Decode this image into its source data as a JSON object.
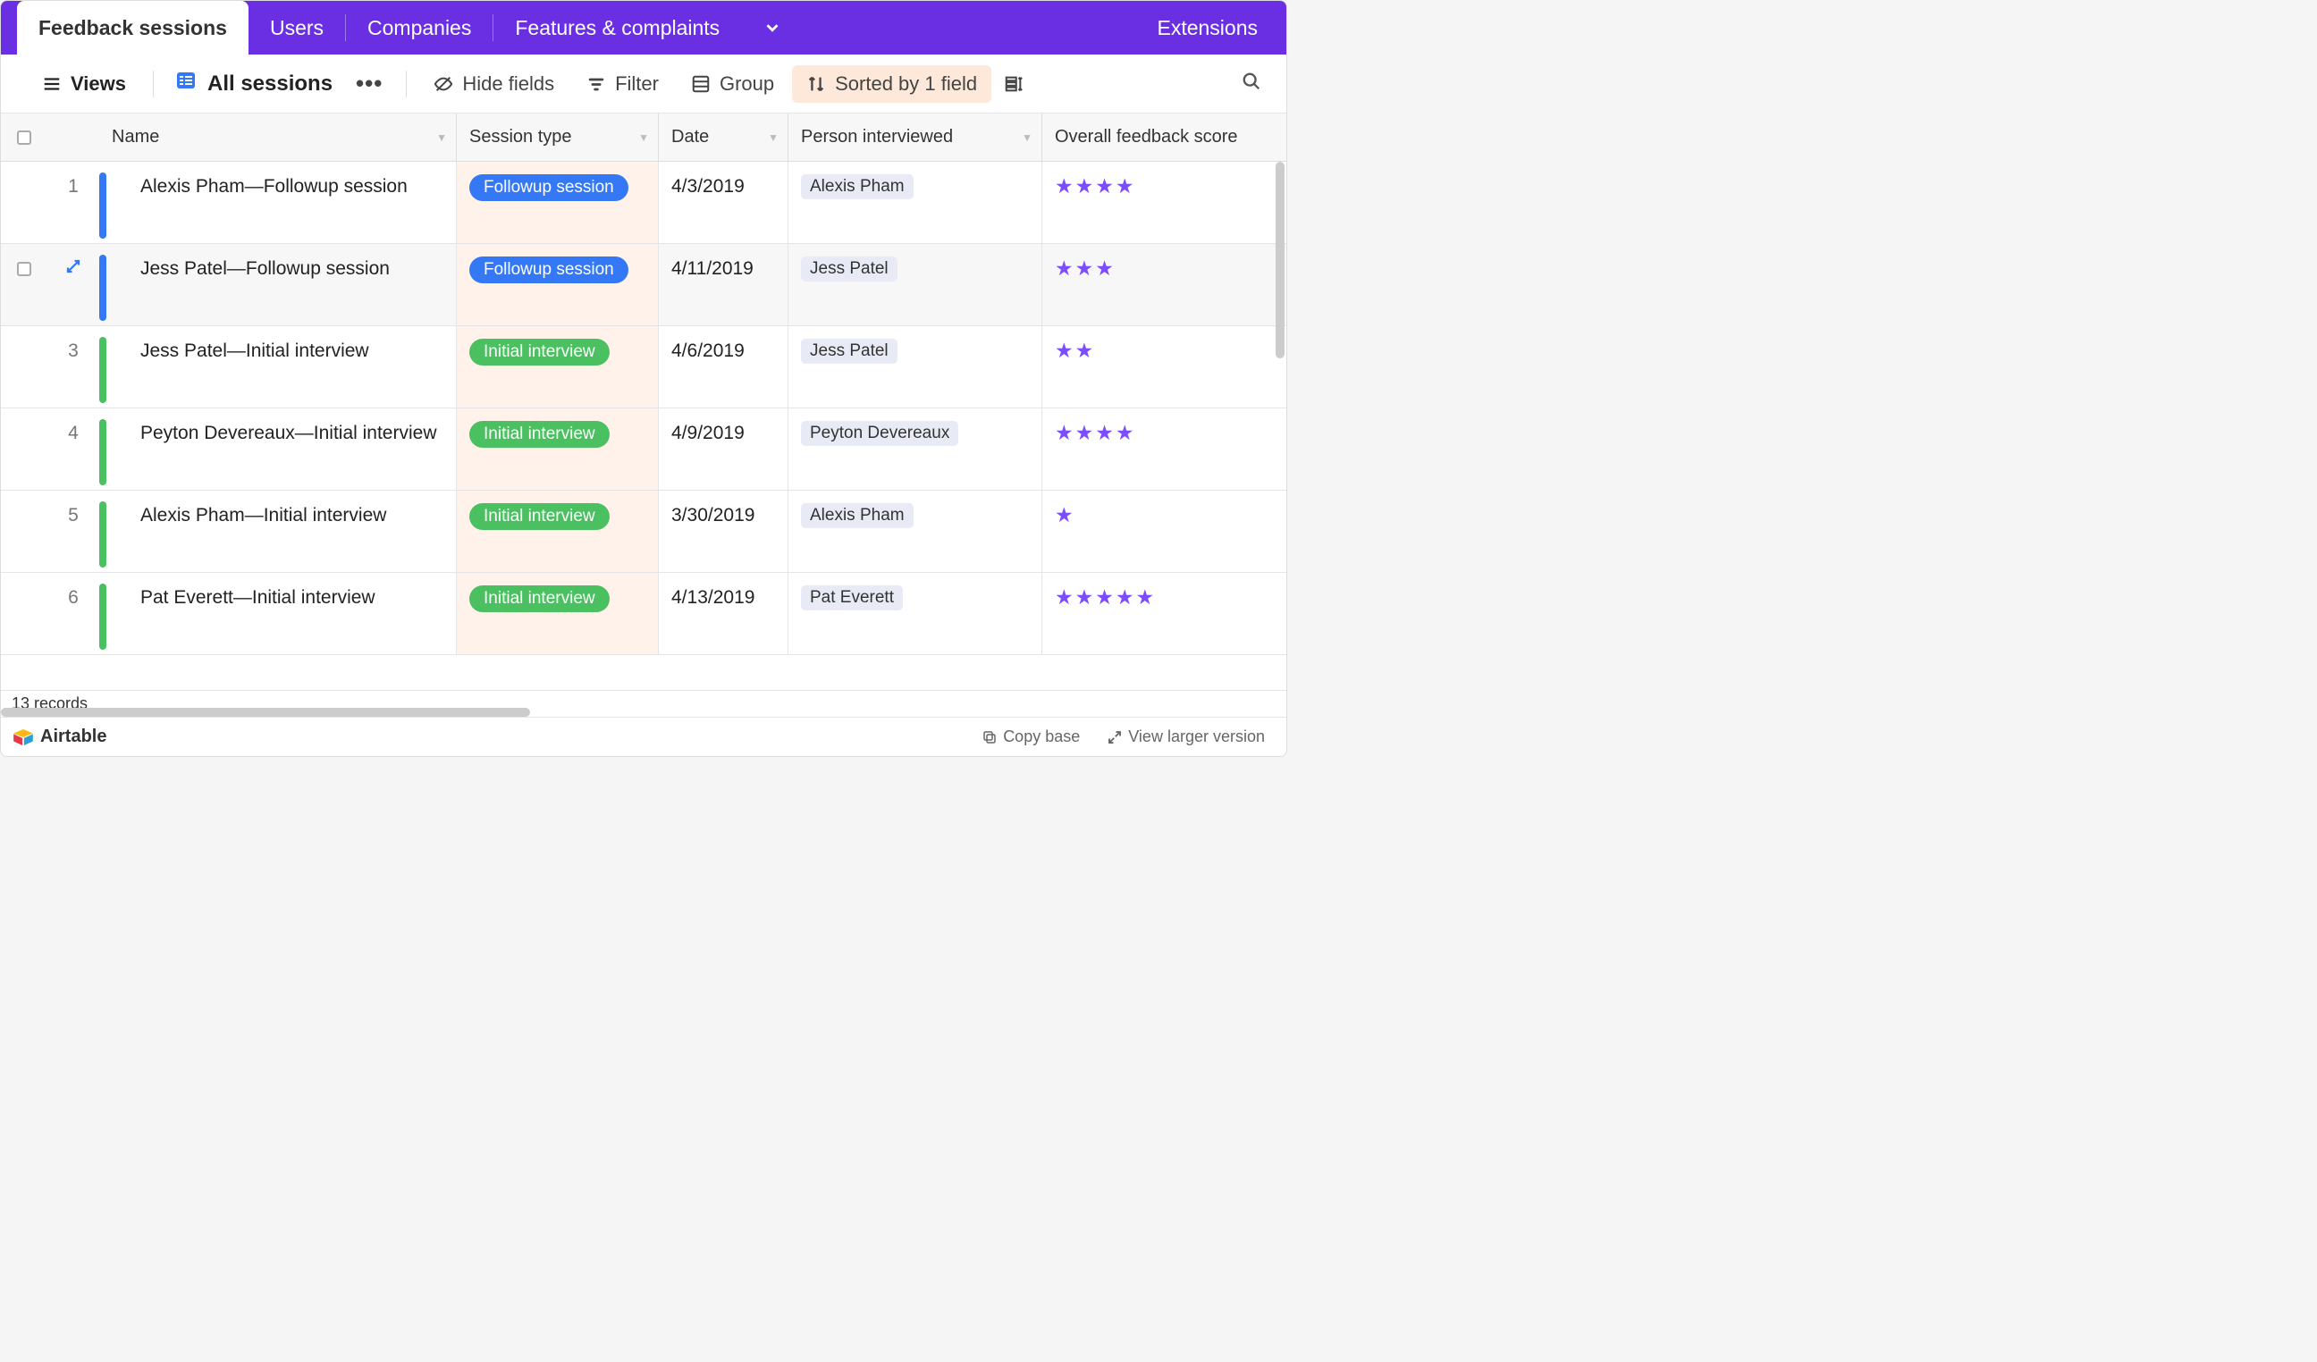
{
  "tabs": {
    "items": [
      {
        "label": "Feedback sessions",
        "active": true
      },
      {
        "label": "Users",
        "active": false
      },
      {
        "label": "Companies",
        "active": false
      },
      {
        "label": "Features & complaints",
        "active": false
      }
    ],
    "extensions_label": "Extensions"
  },
  "toolbar": {
    "views_label": "Views",
    "view_name": "All sessions",
    "hide_fields_label": "Hide fields",
    "filter_label": "Filter",
    "group_label": "Group",
    "sorted_label": "Sorted by 1 field"
  },
  "columns": {
    "name": "Name",
    "session_type": "Session type",
    "date": "Date",
    "person": "Person interviewed",
    "score": "Overall feedback score"
  },
  "rows": [
    {
      "num": "1",
      "color": "#3478F6",
      "name": "Alexis Pham—Followup session",
      "type": "Followup session",
      "type_kind": "followup",
      "date": "4/3/2019",
      "person": "Alexis Pham",
      "stars": 4,
      "hovered": false
    },
    {
      "num": "",
      "color": "#3478F6",
      "name": "Jess Patel—Followup session",
      "type": "Followup session",
      "type_kind": "followup",
      "date": "4/11/2019",
      "person": "Jess Patel",
      "stars": 3,
      "hovered": true
    },
    {
      "num": "3",
      "color": "#4AC060",
      "name": "Jess Patel—Initial interview",
      "type": "Initial interview",
      "type_kind": "initial",
      "date": "4/6/2019",
      "person": "Jess Patel",
      "stars": 2,
      "hovered": false
    },
    {
      "num": "4",
      "color": "#4AC060",
      "name": "Peyton Devereaux—Initial interview",
      "type": "Initial interview",
      "type_kind": "initial",
      "date": "4/9/2019",
      "person": "Peyton Devereaux",
      "stars": 4,
      "hovered": false
    },
    {
      "num": "5",
      "color": "#4AC060",
      "name": "Alexis Pham—Initial interview",
      "type": "Initial interview",
      "type_kind": "initial",
      "date": "3/30/2019",
      "person": "Alexis Pham",
      "stars": 1,
      "hovered": false
    },
    {
      "num": "6",
      "color": "#4AC060",
      "name": "Pat Everett—Initial interview",
      "type": "Initial interview",
      "type_kind": "initial",
      "date": "4/13/2019",
      "person": "Pat Everett",
      "stars": 5,
      "hovered": false
    }
  ],
  "status": {
    "record_count": "13 records"
  },
  "footer": {
    "brand": "Airtable",
    "copy_base": "Copy base",
    "view_larger": "View larger version"
  },
  "colors": {
    "brand_purple": "#6B2FE3",
    "star": "#7C4DFF"
  }
}
